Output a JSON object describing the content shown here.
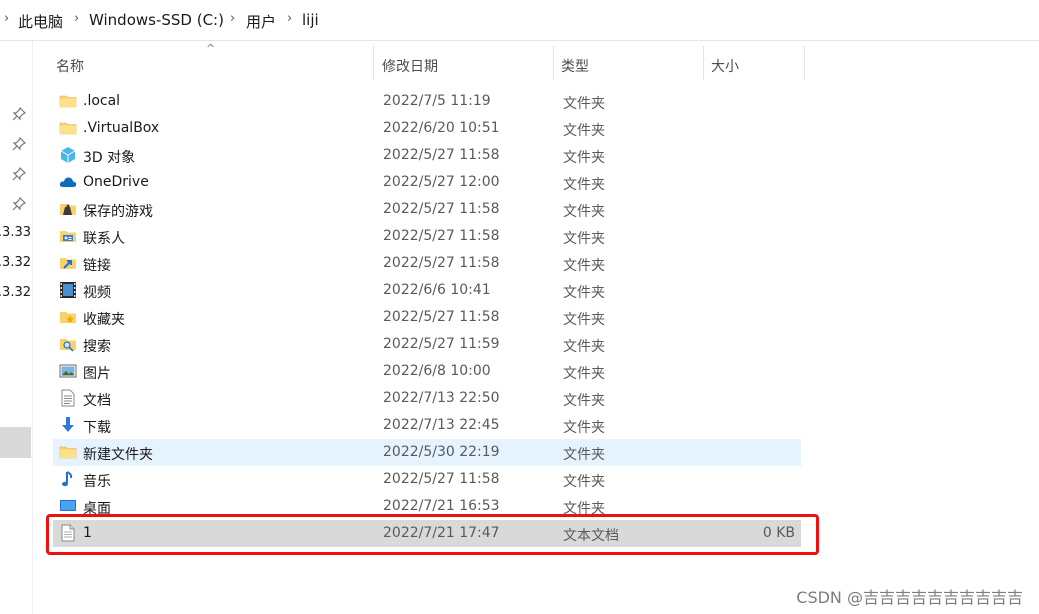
{
  "breadcrumb": [
    "此电脑",
    "Windows-SSD (C:)",
    "用户",
    "liji"
  ],
  "nav": {
    "partial_items": [
      "3.33.",
      "3.32.",
      "3.32."
    ]
  },
  "columns": {
    "name": "名称",
    "date": "修改日期",
    "type": "类型",
    "size": "大小"
  },
  "files": [
    {
      "name": ".local",
      "date": "2022/7/5 11:19",
      "type": "文件夹",
      "size": "",
      "icon": "folder-icon"
    },
    {
      "name": ".VirtualBox",
      "date": "2022/6/20 10:51",
      "type": "文件夹",
      "size": "",
      "icon": "folder-icon"
    },
    {
      "name": "3D 对象",
      "date": "2022/5/27 11:58",
      "type": "文件夹",
      "size": "",
      "icon": "3d-objects-icon"
    },
    {
      "name": "OneDrive",
      "date": "2022/5/27 12:00",
      "type": "文件夹",
      "size": "",
      "icon": "onedrive-cloud-icon"
    },
    {
      "name": "保存的游戏",
      "date": "2022/5/27 11:58",
      "type": "文件夹",
      "size": "",
      "icon": "saved-games-icon"
    },
    {
      "name": "联系人",
      "date": "2022/5/27 11:58",
      "type": "文件夹",
      "size": "",
      "icon": "contacts-icon"
    },
    {
      "name": "链接",
      "date": "2022/5/27 11:58",
      "type": "文件夹",
      "size": "",
      "icon": "links-icon"
    },
    {
      "name": "视频",
      "date": "2022/6/6 10:41",
      "type": "文件夹",
      "size": "",
      "icon": "videos-icon"
    },
    {
      "name": "收藏夹",
      "date": "2022/5/27 11:58",
      "type": "文件夹",
      "size": "",
      "icon": "favorites-icon"
    },
    {
      "name": "搜索",
      "date": "2022/5/27 11:59",
      "type": "文件夹",
      "size": "",
      "icon": "searches-icon"
    },
    {
      "name": "图片",
      "date": "2022/6/8 10:00",
      "type": "文件夹",
      "size": "",
      "icon": "pictures-icon"
    },
    {
      "name": "文档",
      "date": "2022/7/13 22:50",
      "type": "文件夹",
      "size": "",
      "icon": "documents-icon"
    },
    {
      "name": "下载",
      "date": "2022/7/13 22:45",
      "type": "文件夹",
      "size": "",
      "icon": "downloads-icon"
    },
    {
      "name": "新建文件夹",
      "date": "2022/5/30 22:19",
      "type": "文件夹",
      "size": "",
      "icon": "folder-icon",
      "state": "hover"
    },
    {
      "name": "音乐",
      "date": "2022/5/27 11:58",
      "type": "文件夹",
      "size": "",
      "icon": "music-icon"
    },
    {
      "name": "桌面",
      "date": "2022/7/21 16:53",
      "type": "文件夹",
      "size": "",
      "icon": "desktop-icon"
    },
    {
      "name": "1",
      "date": "2022/7/21 17:47",
      "type": "文本文档",
      "size": "0 KB",
      "icon": "text-file-icon",
      "state": "selected"
    }
  ],
  "colors": {
    "hover": "#e5f3ff",
    "selected": "#d9d9d9",
    "highlight": "#ee1111",
    "folder": "#f8d26a"
  },
  "watermark": "CSDN @吉吉吉吉吉吉吉吉吉吉"
}
